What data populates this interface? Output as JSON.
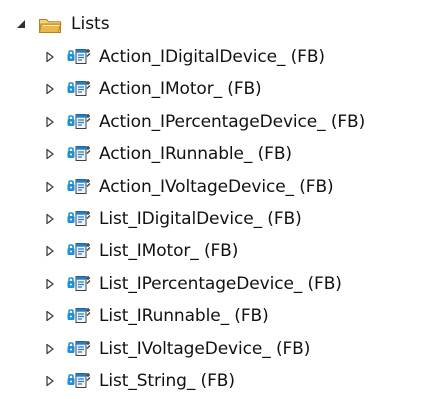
{
  "tree": {
    "root": {
      "label": "Lists",
      "icon": "open-folder-icon",
      "expanded": true
    },
    "children": [
      {
        "label": "Action_IDigitalDevice_ (FB)",
        "icon": "function-block-icon"
      },
      {
        "label": "Action_IMotor_ (FB)",
        "icon": "function-block-icon"
      },
      {
        "label": "Action_IPercentageDevice_ (FB)",
        "icon": "function-block-icon"
      },
      {
        "label": "Action_IRunnable_ (FB)",
        "icon": "function-block-icon"
      },
      {
        "label": "Action_IVoltageDevice_ (FB)",
        "icon": "function-block-icon"
      },
      {
        "label": "List_IDigitalDevice_ (FB)",
        "icon": "function-block-icon"
      },
      {
        "label": "List_IMotor_ (FB)",
        "icon": "function-block-icon"
      },
      {
        "label": "List_IPercentageDevice_ (FB)",
        "icon": "function-block-icon"
      },
      {
        "label": "List_IRunnable_ (FB)",
        "icon": "function-block-icon"
      },
      {
        "label": "List_IVoltageDevice_ (FB)",
        "icon": "function-block-icon"
      },
      {
        "label": "List_String_ (FB)",
        "icon": "function-block-icon"
      }
    ]
  },
  "colors": {
    "folder": "#e8b84c",
    "lock_blue": "#1e90d8",
    "text": "#111111",
    "expander": "#404040"
  }
}
